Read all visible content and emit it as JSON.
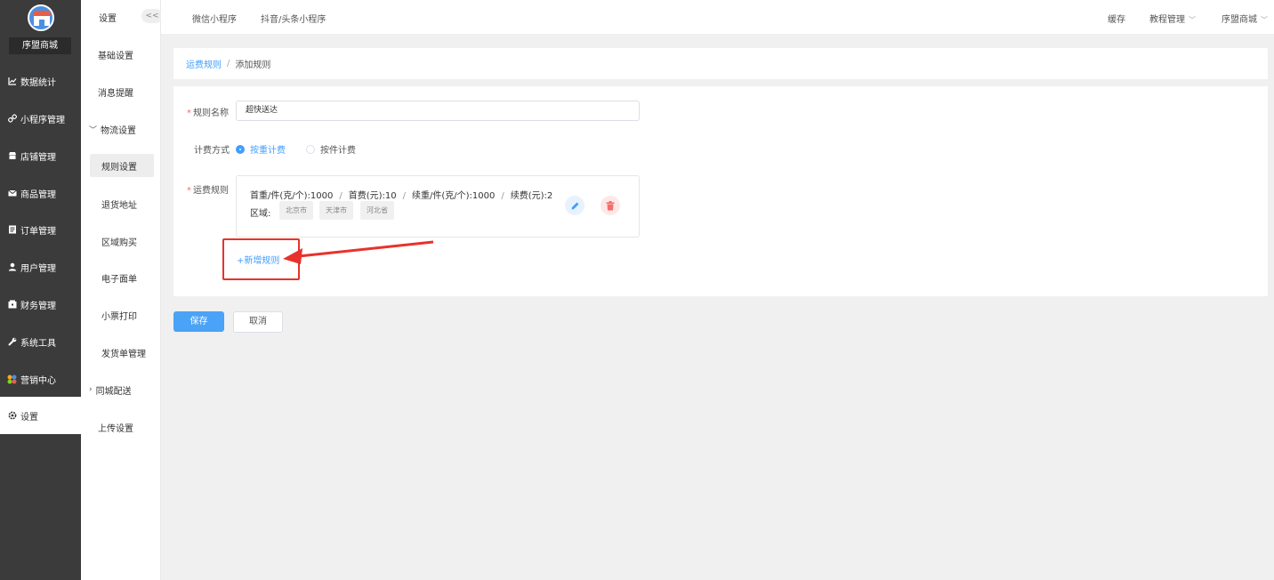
{
  "app": {
    "shop_name": "序盟商城"
  },
  "sidebar": {
    "items": [
      {
        "label": "数据统计",
        "icon": "chart-line-icon"
      },
      {
        "label": "小程序管理",
        "icon": "link-icon"
      },
      {
        "label": "店铺管理",
        "icon": "store-icon"
      },
      {
        "label": "商品管理",
        "icon": "mail-icon"
      },
      {
        "label": "订单管理",
        "icon": "order-icon"
      },
      {
        "label": "用户管理",
        "icon": "user-icon"
      },
      {
        "label": "财务管理",
        "icon": "wallet-icon"
      },
      {
        "label": "系统工具",
        "icon": "wrench-icon"
      },
      {
        "label": "营销中心",
        "icon": "marketing-icon"
      },
      {
        "label": "设置",
        "icon": "gear-icon"
      }
    ]
  },
  "submenu": {
    "title": "设置",
    "collapse_label": "<<",
    "items": [
      {
        "label": "基础设置"
      },
      {
        "label": "消息提醒"
      },
      {
        "label": "物流设置"
      },
      {
        "label": "规则设置"
      },
      {
        "label": "退货地址"
      },
      {
        "label": "区域购买"
      },
      {
        "label": "电子面单"
      },
      {
        "label": "小票打印"
      },
      {
        "label": "发货单管理"
      },
      {
        "label": "同城配送"
      },
      {
        "label": "上传设置"
      }
    ]
  },
  "topbar": {
    "tabs": [
      "微信小程序",
      "抖音/头条小程序"
    ],
    "cache": "缓存",
    "tutorial": "教程管理",
    "shop": "序盟商城"
  },
  "breadcrumb": {
    "parent": "运费规则",
    "separator": "/",
    "current": "添加规则"
  },
  "form": {
    "name_label": "规则名称",
    "name_value": "超快送达",
    "billing_label": "计费方式",
    "billing_options": [
      "按重计费",
      "按件计费"
    ],
    "billing_selected": "按重计费",
    "rules_label": "运费规则",
    "rule": {
      "first_weight": "首重/件(克/个):1000",
      "first_fee": "首费(元):10",
      "extra_weight": "续重/件(克/个):1000",
      "extra_fee": "续费(元):2",
      "separator": "/",
      "region_label": "区域:",
      "regions": [
        "北京市",
        "天津市",
        "河北省"
      ]
    },
    "add_rule": "+新增规则"
  },
  "actions": {
    "save": "保存",
    "cancel": "取消"
  },
  "colors": {
    "primary": "#409eff",
    "danger": "#f56c6c",
    "annotation": "#e8322b",
    "sidebar_bg": "#3b3b3b"
  }
}
